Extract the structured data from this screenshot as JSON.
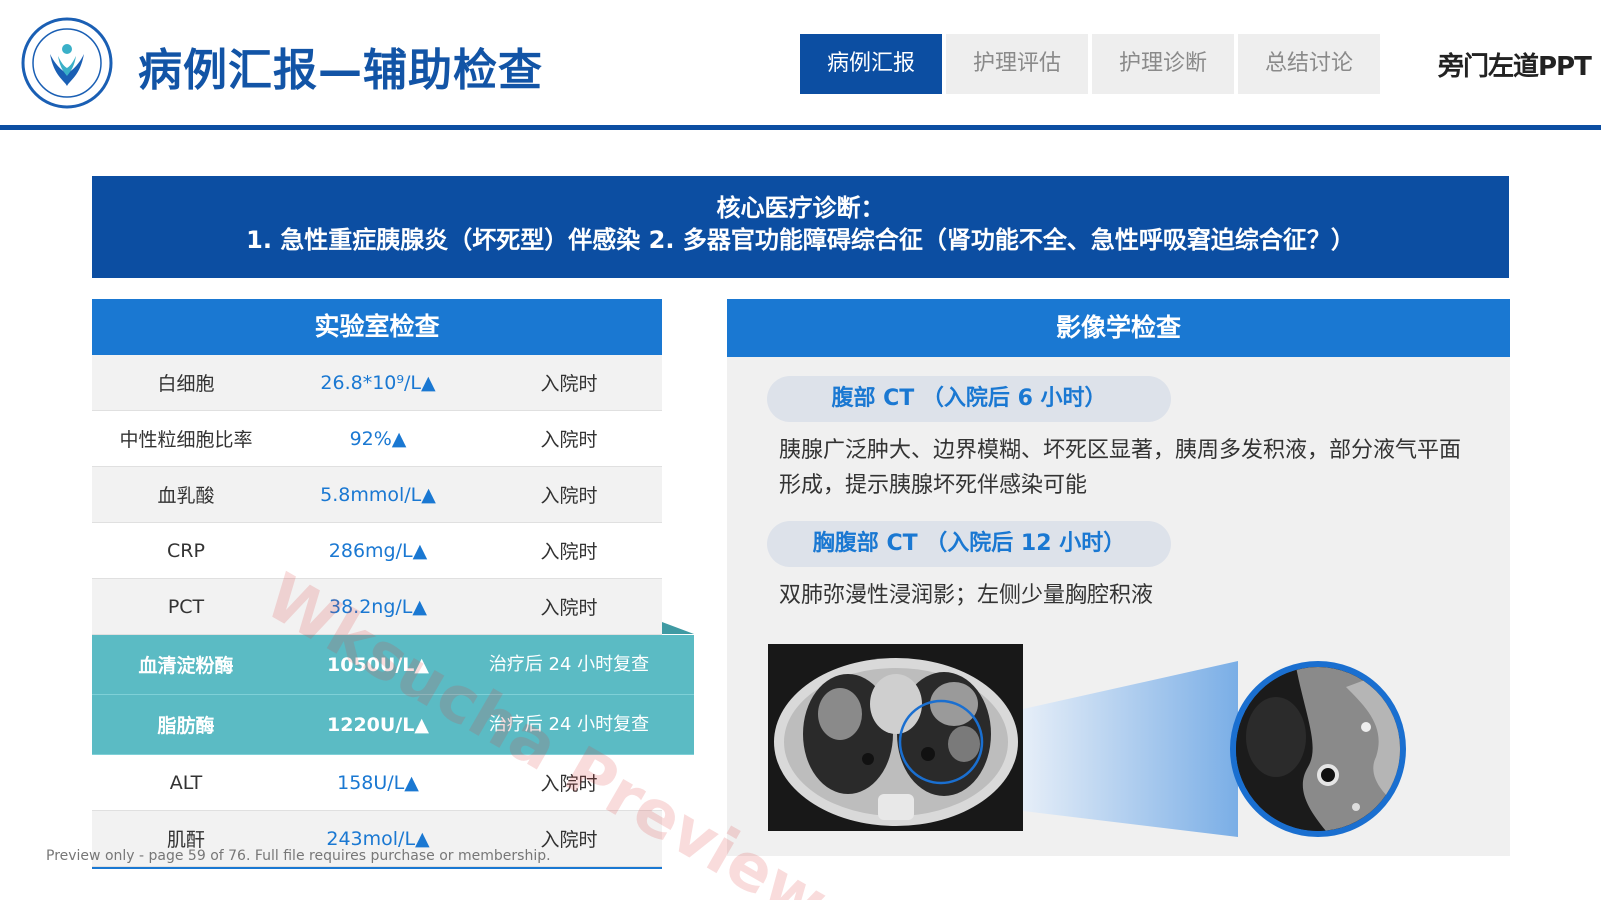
{
  "header": {
    "title": "病例汇报—辅助检查",
    "brand": "旁门左道PPT",
    "tabs": [
      {
        "label": "病例汇报",
        "active": true
      },
      {
        "label": "护理评估",
        "active": false
      },
      {
        "label": "护理诊断",
        "active": false
      },
      {
        "label": "总结讨论",
        "active": false
      }
    ]
  },
  "diagnosis": {
    "heading": "核心医疗诊断：",
    "text": "1. 急性重症胰腺炎（坏死型）伴感染 2. 多器官功能障碍综合征（肾功能不全、急性呼吸窘迫综合征？）"
  },
  "lab": {
    "title": "实验室检查",
    "rows": [
      {
        "item": "白细胞",
        "value": "26.8*10⁹/L▲",
        "time": "入院时",
        "highlight": false
      },
      {
        "item": "中性粒细胞比率",
        "value": "92%▲",
        "time": "入院时",
        "highlight": false
      },
      {
        "item": "血乳酸",
        "value": "5.8mmol/L▲",
        "time": "入院时",
        "highlight": false
      },
      {
        "item": "CRP",
        "value": "286mg/L▲",
        "time": "入院时",
        "highlight": false
      },
      {
        "item": "PCT",
        "value": "38.2ng/L▲",
        "time": "入院时",
        "highlight": false
      },
      {
        "item": "血清淀粉酶",
        "value": "1050U/L▲",
        "time": "治疗后 24 小时复查",
        "highlight": true
      },
      {
        "item": "脂肪酶",
        "value": "1220U/L▲",
        "time": "治疗后 24 小时复查",
        "highlight": true
      },
      {
        "item": "ALT",
        "value": "158U/L▲",
        "time": "入院时",
        "highlight": false
      },
      {
        "item": "肌酐",
        "value": "243mol/L▲",
        "time": "入院时",
        "highlight": false
      }
    ]
  },
  "imaging": {
    "title": "影像学检查",
    "exams": [
      {
        "label": "腹部 CT （入院后 6 小时）",
        "finding": "胰腺广泛肿大、边界模糊、坏死区显著，胰周多发积液，部分液气平面形成，提示胰腺坏死伴感染可能"
      },
      {
        "label": "胸腹部 CT （入院后 12 小时）",
        "finding": "双肺弥漫性浸润影；左侧少量胸腔积液"
      }
    ]
  },
  "footer": {
    "preview_note": "Preview only - page 59 of 76. Full file requires purchase or membership.",
    "watermark": "Wksucha Preview"
  },
  "colors": {
    "primary": "#0c4ea2",
    "accent": "#1a78d2",
    "highlight_row": "#5bbbc4"
  }
}
